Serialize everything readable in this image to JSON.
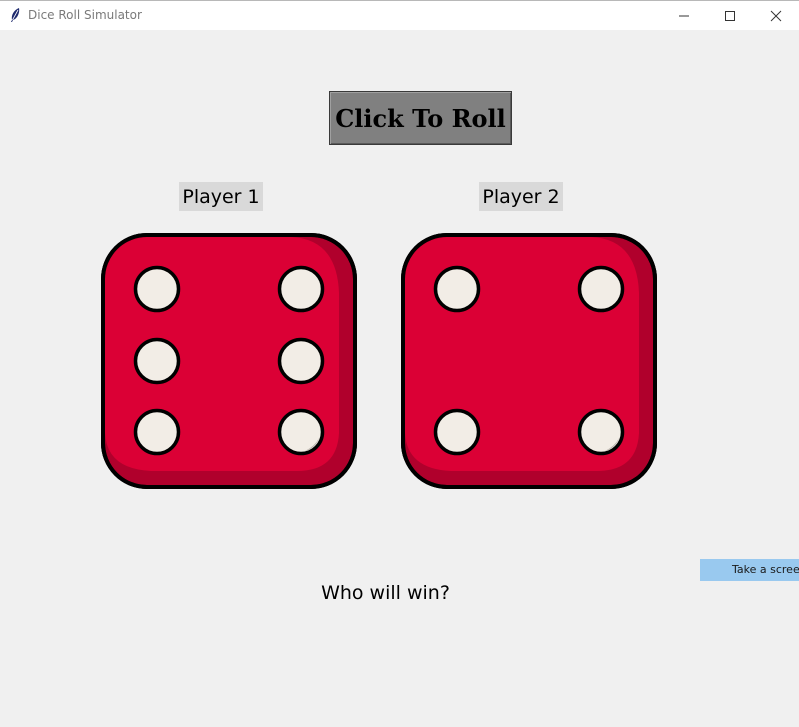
{
  "window": {
    "title": "Dice Roll Simulator",
    "icon": "feather-icon"
  },
  "controls": {
    "roll_label": "Click To Roll"
  },
  "players": [
    {
      "label": "Player 1",
      "die_value": 6
    },
    {
      "label": "Player 2",
      "die_value": 4
    }
  ],
  "result": {
    "text": "Who will win?"
  },
  "screenshot_tab": {
    "label": "Take a screen"
  },
  "colors": {
    "die_face": "#db0035",
    "die_edge": "#b0002c",
    "pip": "#f2ede6",
    "button": "#808080",
    "label_bg": "#d9d9d9",
    "background": "#f0f0f0",
    "tab_bg": "#99c9ef"
  }
}
